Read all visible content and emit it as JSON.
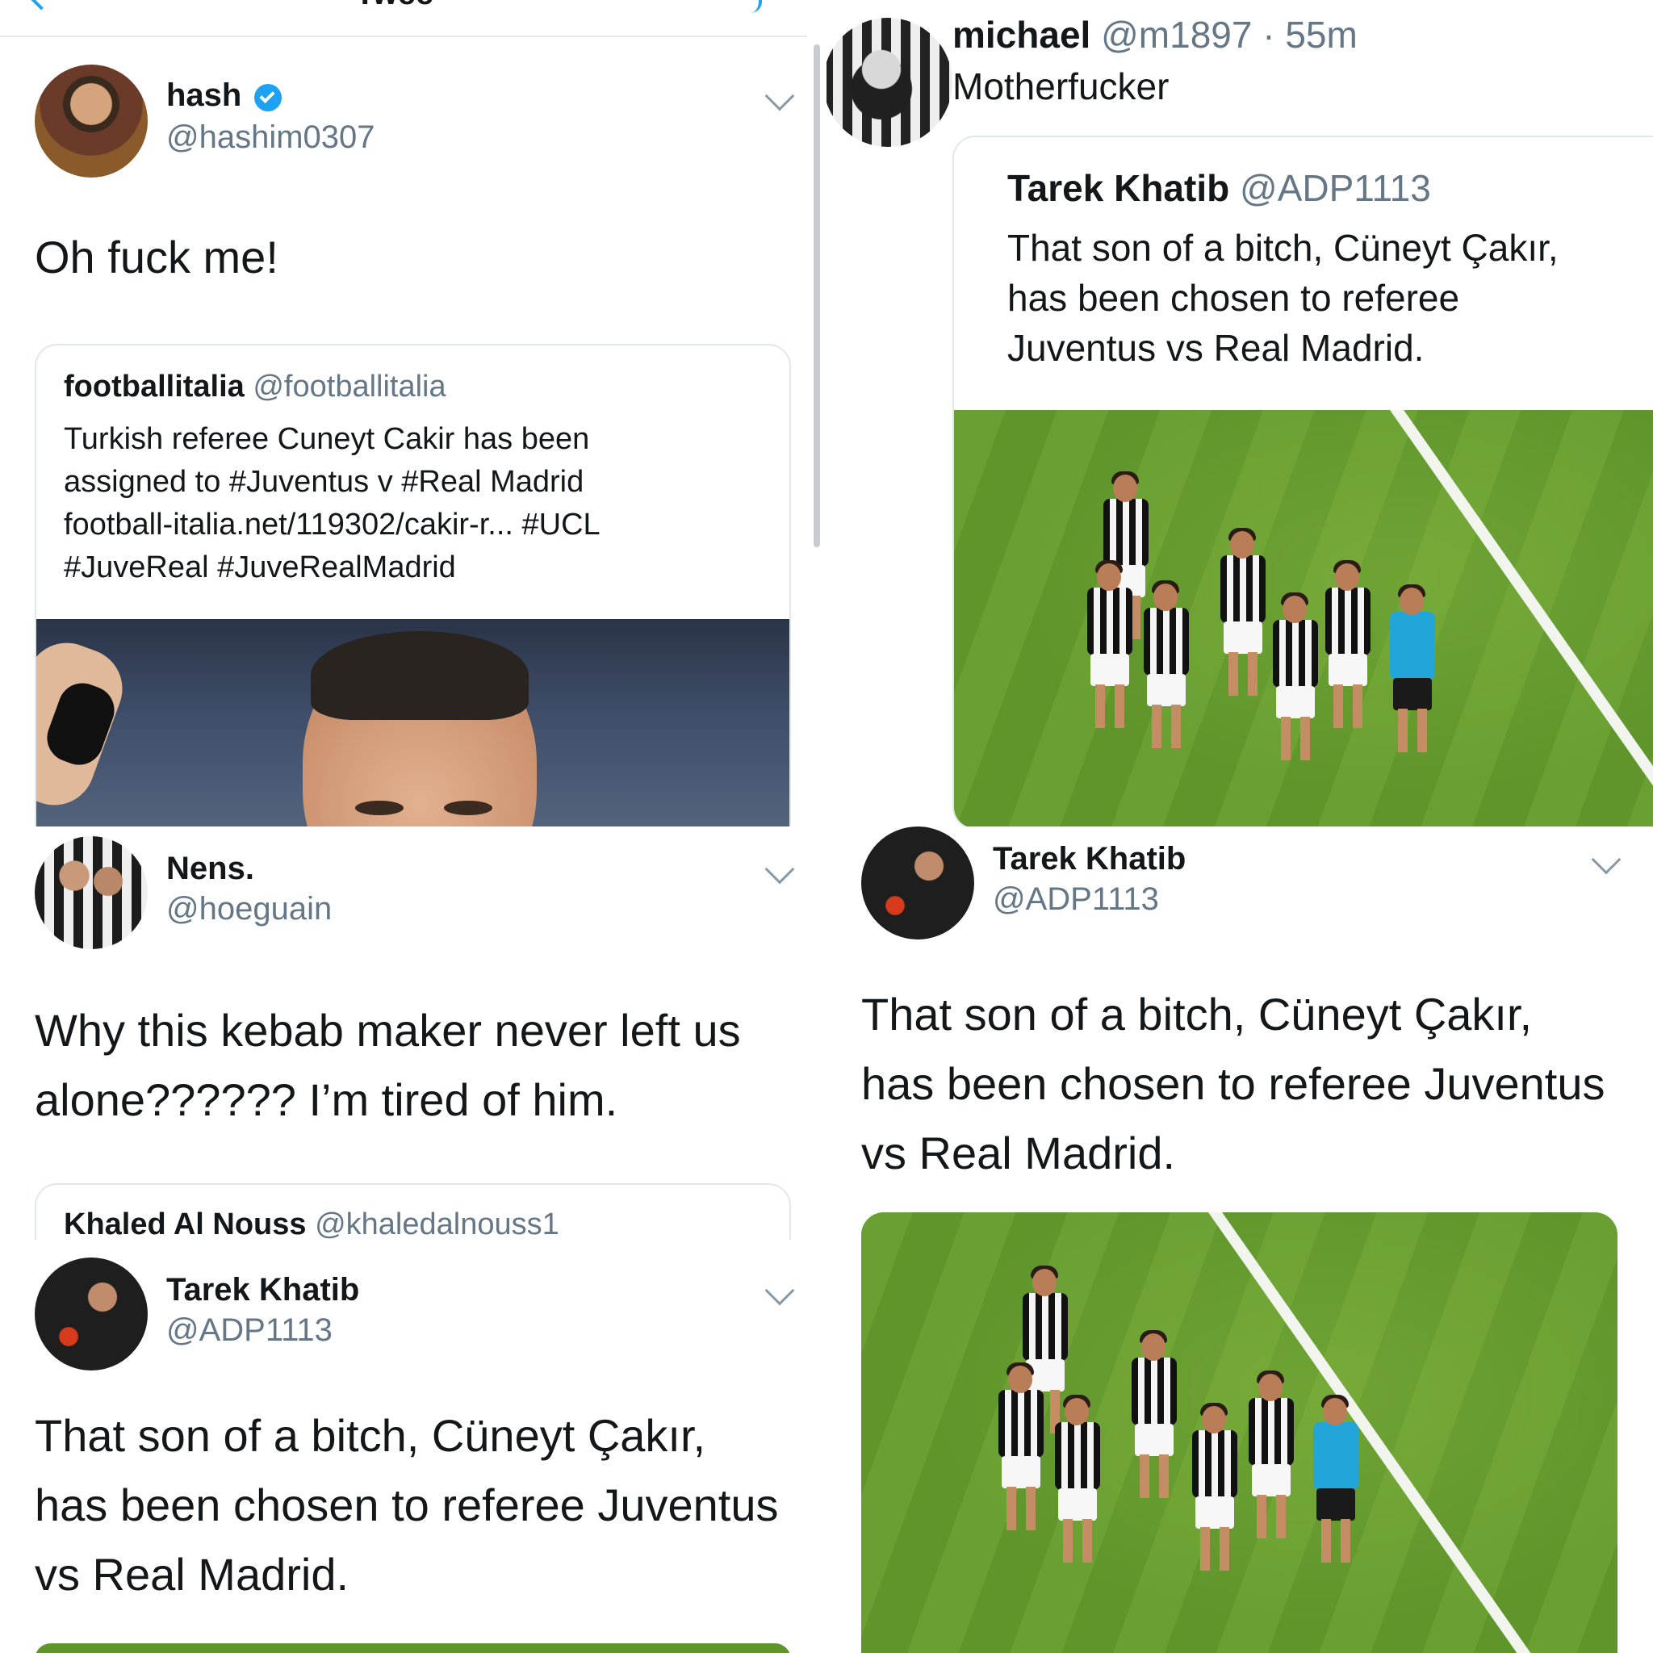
{
  "colors": {
    "link_blue": "#1da1f2",
    "text_primary": "#14171a",
    "text_secondary": "#657786",
    "border": "#e1e8ed",
    "verified": "#1da1f2"
  },
  "top_left": {
    "header_title_partial": "Twee",
    "back_icon": "chevron-left-icon"
  },
  "tweet_hash": {
    "name": "hash",
    "verified": true,
    "handle": "@hashim0307",
    "text": "Oh fuck me!",
    "quote": {
      "name": "footballitalia",
      "handle": "@footballitalia",
      "lines": [
        "Turkish referee Cuneyt Cakir has been",
        "assigned to #Juventus v #Real Madrid",
        "football-italia.net/119302/cakir-r... #UCL",
        "#JuveReal #JuveRealMadrid"
      ]
    }
  },
  "tweet_nens": {
    "name": "Nens.",
    "handle": "@hoeguain",
    "lines": [
      "Why this kebab maker never left us",
      "alone?????? I’m tired of him."
    ],
    "quote": {
      "name": "Khaled Al Nouss",
      "handle": "@khaledalnouss1"
    }
  },
  "tweet_tarek_bl": {
    "name": "Tarek Khatib",
    "handle": "@ADP1113",
    "lines": [
      "That son of a bitch, Cüneyt Çakır,",
      "has been chosen to referee Juventus",
      "vs Real Madrid."
    ]
  },
  "tweet_michael": {
    "name": "michael",
    "handle": "@m1897",
    "time": "· 55m",
    "text": "Motherfucker",
    "quote": {
      "name": "Tarek Khatib",
      "handle": "@ADP1113",
      "lines": [
        "That son of a bitch, Cüneyt Çakır,",
        "has been chosen to referee",
        "Juventus vs Real Madrid."
      ]
    }
  },
  "tweet_tarek_br": {
    "name": "Tarek Khatib",
    "handle": "@ADP1113",
    "lines": [
      "That son of a bitch, Cüneyt Çakır,",
      "has been chosen to referee Juventus",
      "vs Real Madrid."
    ]
  }
}
